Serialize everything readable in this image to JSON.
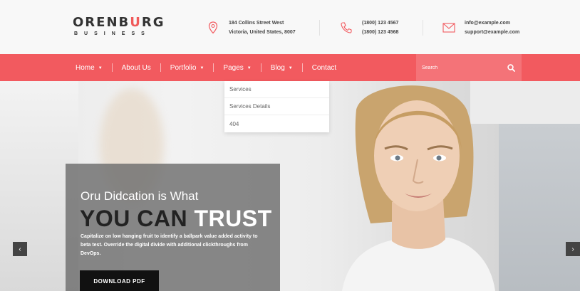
{
  "brand": {
    "name_part1": "ORENB",
    "name_accent": "U",
    "name_part2": "RG",
    "tagline": "BUSINESS"
  },
  "contact": {
    "address": {
      "icon": "map-pin-icon",
      "line1": "184 Collins Street West",
      "line2": "Victoria, United States, 8007"
    },
    "phone": {
      "icon": "phone-icon",
      "line1": "(1800) 123 4567",
      "line2": "(1800) 123 4568"
    },
    "email": {
      "icon": "envelope-icon",
      "line1": "info@example.com",
      "line2": "support@example.com"
    }
  },
  "nav": {
    "home": "Home",
    "about": "About Us",
    "portfolio": "Portfolio",
    "pages": "Pages",
    "blog": "Blog",
    "contact": "Contact",
    "caret": "▼"
  },
  "search": {
    "placeholder": "Search",
    "icon": "search-icon"
  },
  "dropdown": {
    "item1": "Services",
    "item2": "Services Details",
    "item3": "404"
  },
  "hero": {
    "subtitle": "Oru Didcation is What",
    "title_dark": "YOU CAN",
    "title_light": "TRUST",
    "description": "Capitalize on low hanging fruit to identify a ballpark value added activity to beta test. Override the digital divide with additional clickthroughs from DevOps.",
    "button": "DOWNLOAD PDF",
    "prev_arrow": "‹",
    "next_arrow": "›"
  },
  "colors": {
    "accent": "#f25a5f",
    "search_bg": "#f47378",
    "button_bg": "#111111"
  }
}
